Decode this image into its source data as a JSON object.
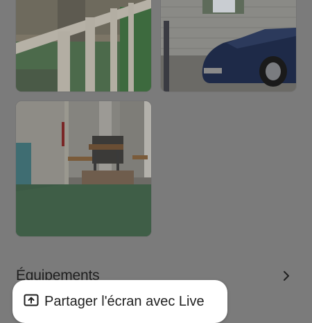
{
  "gallery": {
    "photos": [
      {
        "alt": "terrace-railing-photo"
      },
      {
        "alt": "mobile-home-with-car-photo"
      },
      {
        "alt": "covered-terrace-with-table-photo"
      }
    ]
  },
  "amenities": {
    "title": "Équipements"
  },
  "share_banner": {
    "label": "Partager l'écran avec Live"
  },
  "colors": {
    "overlay": "#7b7b7b",
    "pill_bg": "#ffffff",
    "text": "#1f1f1f"
  }
}
